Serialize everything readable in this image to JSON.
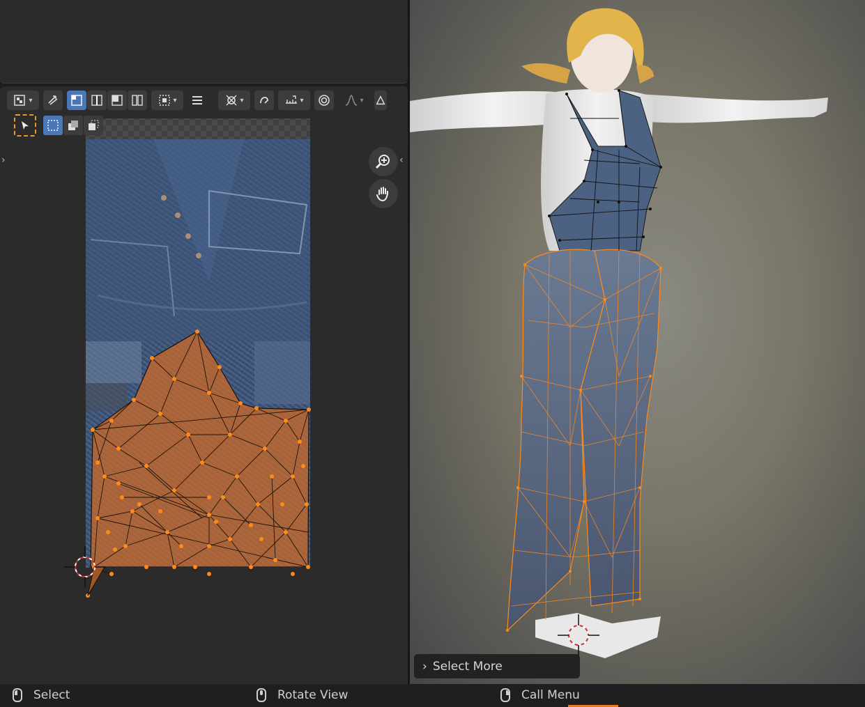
{
  "status_bar": {
    "select_label": "Select",
    "rotate_label": "Rotate View",
    "menu_label": "Call Menu"
  },
  "operator_panel": {
    "label": "Select More"
  },
  "colors": {
    "accent": "#4a77b8",
    "selection": "#e87a1a",
    "vertex": "#ff8a1a",
    "header_bg": "#2b2b2b"
  },
  "icons": {
    "editor_type": "uv-editor-icon",
    "sync": "uv-sync-icon",
    "select_modes": [
      "vertex-select-icon",
      "edge-select-icon",
      "face-select-icon",
      "island-select-icon"
    ],
    "sticky": "sticky-select-icon",
    "menu": "hamburger-icon",
    "pivot": "pivot-icon",
    "snap": "snap-icon",
    "snap_target": "snap-increment-icon",
    "proportional": "proportional-editing-icon",
    "falloff": "falloff-curve-icon",
    "image": "image-icon",
    "zoom": "zoom-icon",
    "pan": "hand-icon"
  }
}
